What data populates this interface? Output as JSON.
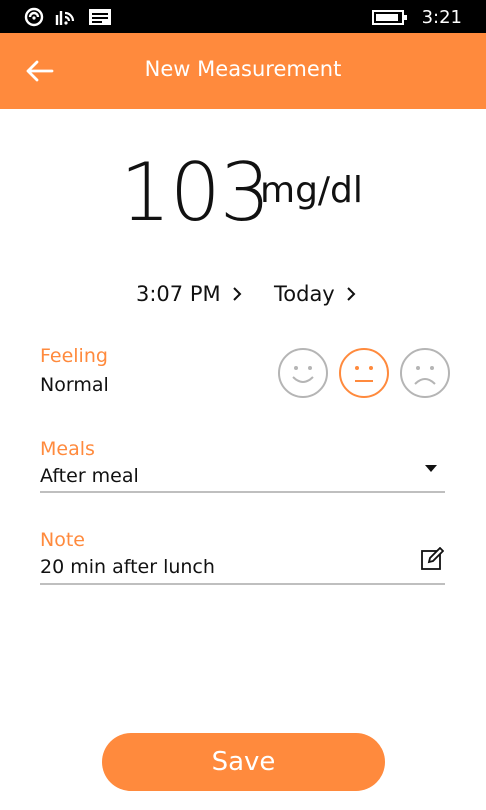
{
  "status_bar": {
    "time": "3:21",
    "icons": [
      "nfc-icon",
      "signal-icon",
      "message-icon",
      "battery-icon"
    ]
  },
  "header": {
    "title": "New Measurement",
    "back_icon": "back-arrow-icon"
  },
  "reading": {
    "value": "103",
    "unit": "mg/dl"
  },
  "datetime": {
    "time": "3:07 PM",
    "date": "Today"
  },
  "feeling": {
    "label": "Feeling",
    "value": "Normal",
    "options": [
      "happy-face-icon",
      "neutral-face-icon",
      "sad-face-icon"
    ],
    "selected": "neutral-face-icon"
  },
  "meals": {
    "label": "Meals",
    "value": "After meal"
  },
  "note": {
    "label": "Note",
    "value": "20 min after lunch"
  },
  "actions": {
    "save_label": "Save"
  },
  "colors": {
    "accent": "#FF8A3D",
    "face_inactive": "#B5B5B5",
    "underline": "#BFBFBF"
  }
}
